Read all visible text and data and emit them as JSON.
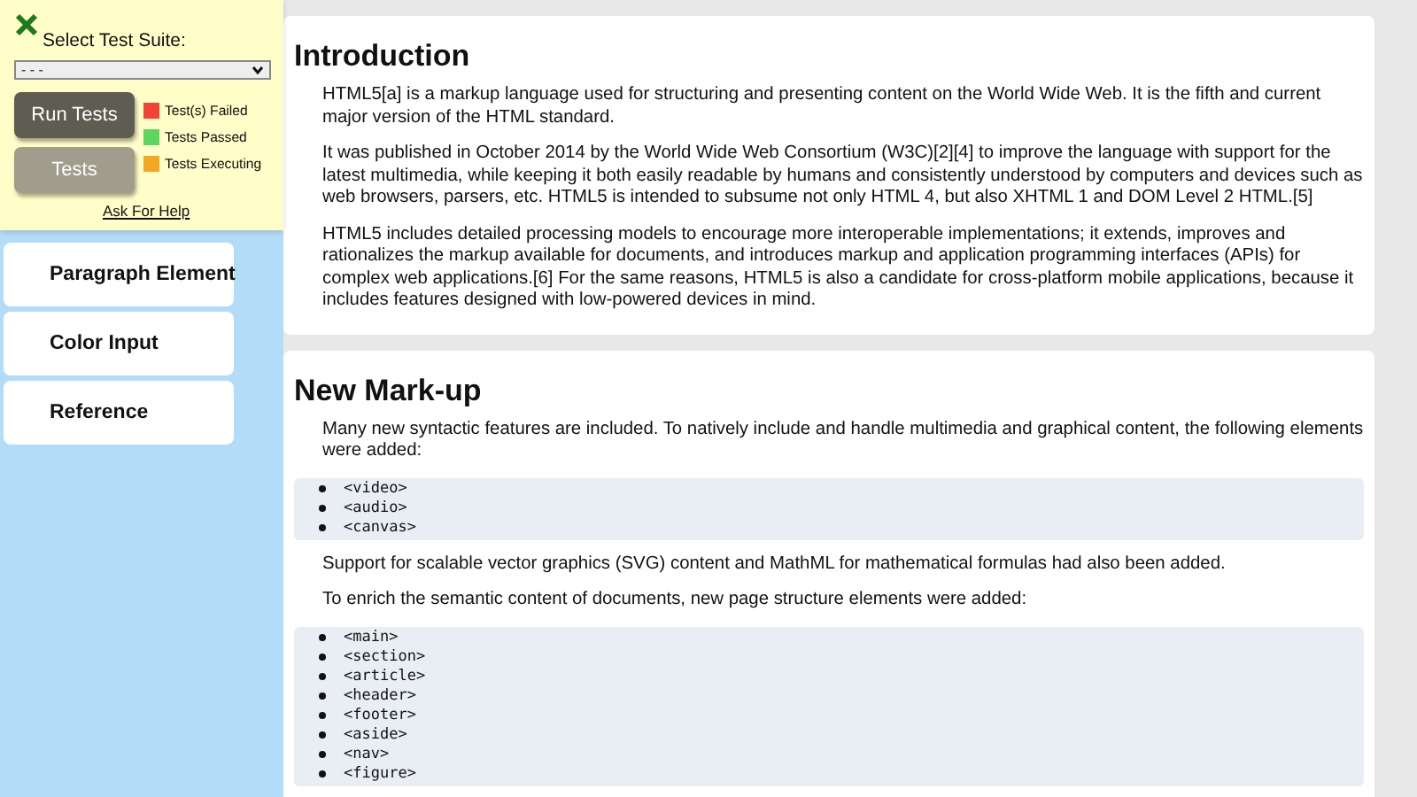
{
  "sidebar": {
    "items": [
      {
        "label": "Paragraph Element"
      },
      {
        "label": "Color Input"
      },
      {
        "label": "Reference"
      }
    ]
  },
  "test_panel": {
    "title": "Select Test Suite:",
    "suite_select": {
      "value": "- - -"
    },
    "buttons": [
      {
        "label": "Run Tests",
        "kind": "primary"
      },
      {
        "label": "Tests",
        "kind": "secondary"
      }
    ],
    "legend": [
      {
        "label": "Test(s) Failed",
        "color": "#f44336"
      },
      {
        "label": "Tests Passed",
        "color": "#5cd65c"
      },
      {
        "label": "Tests Executing",
        "color": "#f5a623"
      }
    ],
    "help_link": "Ask For Help"
  },
  "sections": [
    {
      "heading": "Introduction",
      "blocks": [
        {
          "kind": "text",
          "text": "HTML5[a] is a markup language used for structuring and presenting content on the World Wide Web. It is the fifth and current major version of the HTML standard."
        },
        {
          "kind": "text",
          "text": "It was published in October 2014 by the World Wide Web Consortium (W3C)[2][4] to improve the language with support for the latest multimedia, while keeping it both easily readable by humans and consistently understood by computers and devices such as web browsers, parsers, etc. HTML5 is intended to subsume not only HTML 4, but also XHTML 1 and DOM Level 2 HTML.[5]"
        },
        {
          "kind": "text",
          "text": "HTML5 includes detailed processing models to encourage more interoperable implementations; it extends, improves and rationalizes the markup available for documents, and introduces markup and application programming interfaces (APIs) for complex web applications.[6] For the same reasons, HTML5 is also a candidate for cross-platform mobile applications, because it includes features designed with low-powered devices in mind."
        }
      ]
    },
    {
      "heading": "New Mark-up",
      "blocks": [
        {
          "kind": "text",
          "text": "Many new syntactic features are included. To natively include and handle multimedia and graphical content, the following elements were added:"
        },
        {
          "kind": "code_list",
          "items": [
            "<video>",
            "<audio>",
            "<canvas>"
          ]
        },
        {
          "kind": "text",
          "text": "Support for scalable vector graphics (SVG) content and MathML for mathematical formulas had also been added."
        },
        {
          "kind": "text",
          "text": "To enrich the semantic content of documents, new page structure elements were added:"
        },
        {
          "kind": "code_list",
          "items": [
            "<main>",
            "<section>",
            "<article>",
            "<header>",
            "<footer>",
            "<aside>",
            "<nav>",
            "<figure>"
          ]
        }
      ]
    }
  ]
}
